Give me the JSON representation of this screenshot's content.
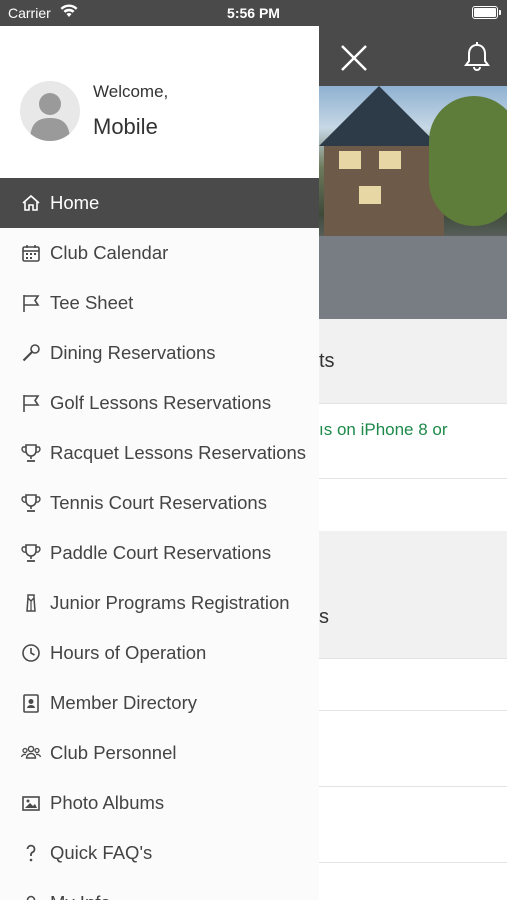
{
  "status_bar": {
    "carrier": "Carrier",
    "time": "5:56 PM"
  },
  "drawer": {
    "welcome": "Welcome,",
    "user_name": "Mobile",
    "items": [
      {
        "label": "Home",
        "icon": "home-icon",
        "active": true
      },
      {
        "label": "Club Calendar",
        "icon": "calendar-icon"
      },
      {
        "label": "Tee Sheet",
        "icon": "flag-icon"
      },
      {
        "label": "Dining Reservations",
        "icon": "utensil-icon"
      },
      {
        "label": "Golf Lessons Reservations",
        "icon": "flag-icon"
      },
      {
        "label": "Racquet Lessons Reservations",
        "icon": "trophy-icon"
      },
      {
        "label": "Tennis Court Reservations",
        "icon": "trophy-icon"
      },
      {
        "label": "Paddle Court Reservations",
        "icon": "trophy-icon"
      },
      {
        "label": "Junior Programs Registration",
        "icon": "shirt-icon"
      },
      {
        "label": "Hours of Operation",
        "icon": "clock-icon"
      },
      {
        "label": "Member Directory",
        "icon": "contact-icon"
      },
      {
        "label": "Club Personnel",
        "icon": "people-icon"
      },
      {
        "label": "Photo Albums",
        "icon": "image-icon"
      },
      {
        "label": "Quick FAQ's",
        "icon": "question-icon"
      },
      {
        "label": "My Info",
        "icon": "user-icon"
      }
    ]
  },
  "page": {
    "section1_title_fragment": "ts",
    "link_fragment": "ıs on iPhone 8 or",
    "section2_title_fragment": "s"
  },
  "colors": {
    "header": "#4a4a4a",
    "link": "#1d8a4a",
    "active_item": "#4a4a4a"
  }
}
